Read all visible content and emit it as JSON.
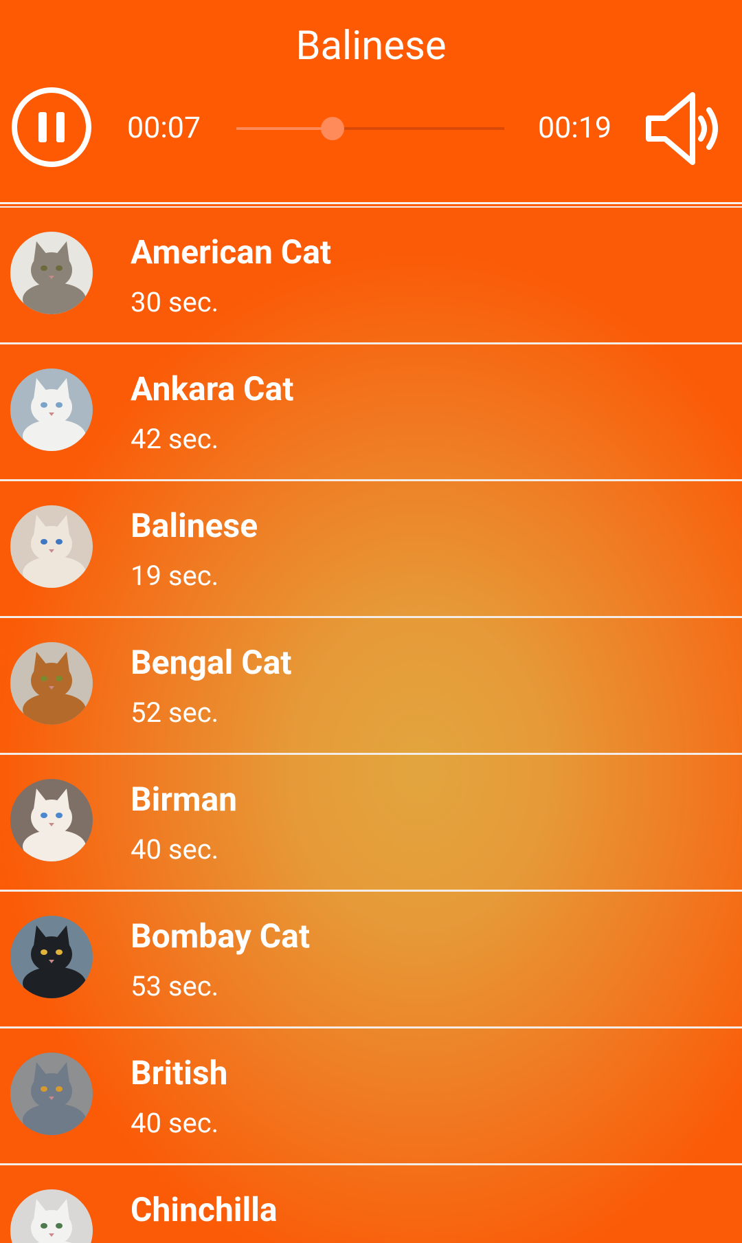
{
  "player": {
    "now_playing": "Balinese",
    "elapsed": "00:07",
    "total": "00:19",
    "progress": 0.36,
    "state": "playing",
    "icons": {
      "pause": "pause-icon",
      "volume": "volume-icon"
    }
  },
  "colors": {
    "header": "#fe5a03",
    "gradient_center": "#e2a53e",
    "gradient_edge": "#fb5a06",
    "divider": "#f4ece6",
    "seek_track": "#d94a08",
    "seek_fill": "#ff8a5a"
  },
  "sounds": [
    {
      "name": "American Cat",
      "duration": "30 sec.",
      "avatar": "tabby-kitten",
      "avatar_bg": "#e8e6e1",
      "cat_color": "#8c8378",
      "eye_color": "#6d6a3c"
    },
    {
      "name": "Ankara Cat",
      "duration": "42 sec.",
      "avatar": "white-cat",
      "avatar_bg": "#a9b8c2",
      "cat_color": "#f1f1ef",
      "eye_color": "#7aa3c9"
    },
    {
      "name": "Balinese",
      "duration": "19 sec.",
      "avatar": "siamese-cat",
      "avatar_bg": "#d8cdc0",
      "cat_color": "#efe6db",
      "eye_color": "#3f77c2"
    },
    {
      "name": "Bengal Cat",
      "duration": "52 sec.",
      "avatar": "bengal-cat",
      "avatar_bg": "#c9c1b5",
      "cat_color": "#b46a2b",
      "eye_color": "#7b8a2e"
    },
    {
      "name": "Birman",
      "duration": "40 sec.",
      "avatar": "birman-cat",
      "avatar_bg": "#7f7067",
      "cat_color": "#f3ede6",
      "eye_color": "#4b86cf"
    },
    {
      "name": "Bombay Cat",
      "duration": "53 sec.",
      "avatar": "black-cat",
      "avatar_bg": "#6f8494",
      "cat_color": "#1d2025",
      "eye_color": "#e0b43a"
    },
    {
      "name": "British",
      "duration": "40 sec.",
      "avatar": "grey-cat",
      "avatar_bg": "#8e8f91",
      "cat_color": "#6f7b88",
      "eye_color": "#d69a2e"
    },
    {
      "name": "Chinchilla",
      "duration": "",
      "avatar": "chinchilla-cat",
      "avatar_bg": "#d9d8d7",
      "cat_color": "#f2f2f1",
      "eye_color": "#4d7a4d"
    }
  ]
}
